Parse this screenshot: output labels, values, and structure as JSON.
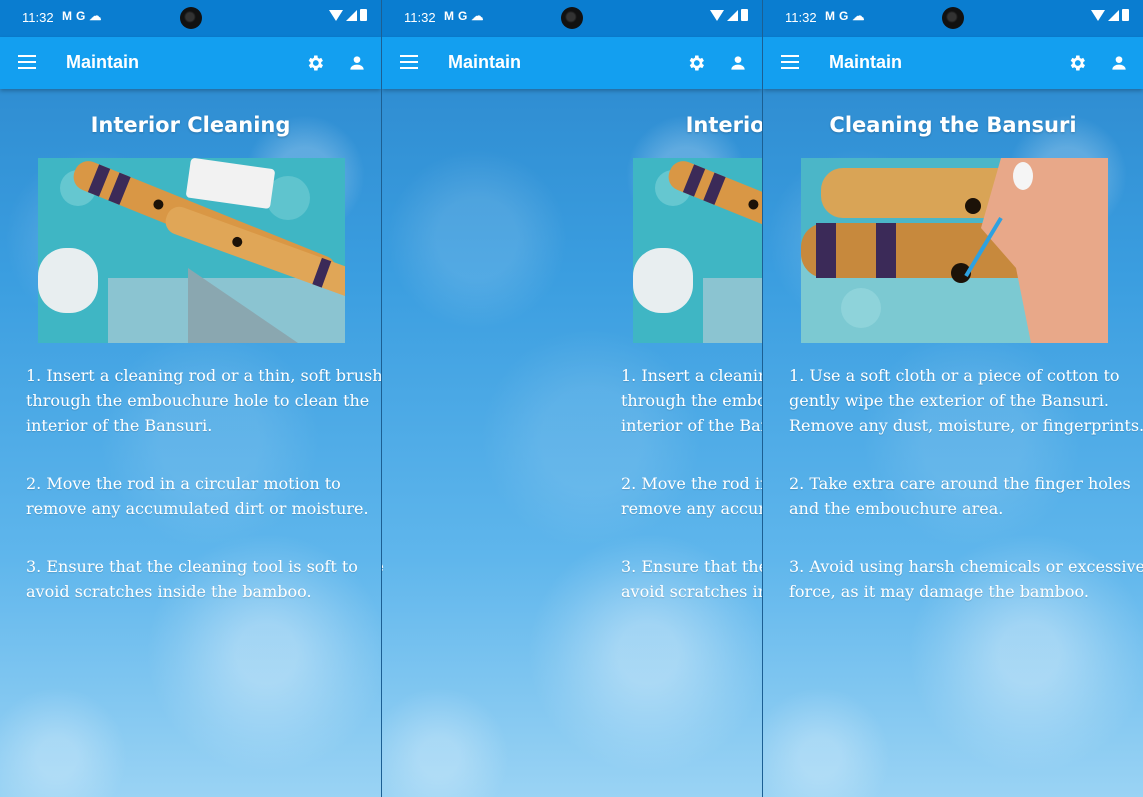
{
  "status": {
    "time": "11:32",
    "icons": [
      "M",
      "G"
    ]
  },
  "appbar": {
    "title": "Maintain"
  },
  "screens": [
    {
      "heading": "Interior Cleaning",
      "steps": [
        [
          "1. Insert a cleaning rod or a thin, soft brush",
          "through the embouchure hole to clean the",
          "interior of the Bansuri."
        ],
        [
          "2. Move the rod in a circular motion to",
          "remove any accumulated dirt or moisture."
        ],
        [
          "3. Ensure that the cleaning tool is soft to",
          "avoid scratches inside the bamboo."
        ]
      ]
    },
    {
      "heading": "Cleaning the Bansuri",
      "steps": [
        [
          "1. Use a soft cloth or a piece of cotton to",
          "gently wipe the exterior of the Bansuri.",
          "Remove any dust, moisture, or fingerprints."
        ],
        [
          "2. Take extra care around the finger holes",
          "and the embouchure area."
        ],
        [
          "3. Avoid using harsh chemicals or excessive",
          "force, as it may damage the bamboo."
        ]
      ]
    }
  ],
  "colors": {
    "statusbar": "#0a7dd0",
    "appbar": "#139ff0",
    "text": "#ffffff"
  },
  "icons": [
    "menu-icon",
    "gear-icon",
    "person-icon",
    "wifi-icon",
    "signal-icon",
    "battery-icon"
  ]
}
